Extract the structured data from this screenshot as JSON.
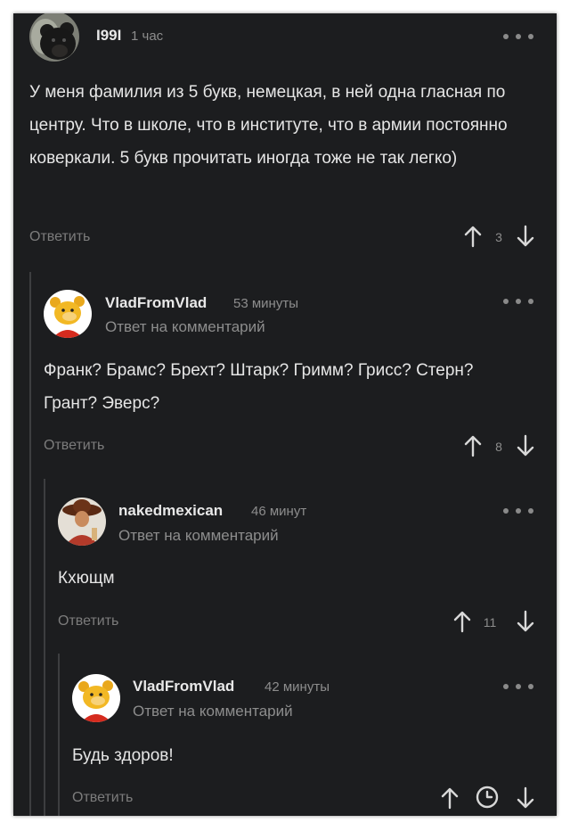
{
  "comments": [
    {
      "author": "I99I",
      "time": "1 час",
      "text": "У меня фамилия из 5 букв, немецкая, в ней одна гласная по центру. Что в школе, что в институте, что в армии постоянно коверкали. 5 букв прочитать иногда тоже не так легко)",
      "reply_label": "Ответить",
      "rating": "3",
      "avatar_icon": "bear-avatar"
    },
    {
      "author": "VladFromVlad",
      "time": "53 минуты",
      "subtitle": "Ответ на комментарий",
      "text": "Франк? Брамс? Брехт? Штарк? Гримм? Грисс? Стерн? Грант? Эверс?",
      "reply_label": "Ответить",
      "rating": "8",
      "avatar_icon": "winnie-avatar"
    },
    {
      "author": "nakedmexican",
      "time": "46 минут",
      "subtitle": "Ответ на комментарий",
      "text": "Кхющм",
      "reply_label": "Ответить",
      "rating": "11",
      "avatar_icon": "mexican-avatar"
    },
    {
      "author": "VladFromVlad",
      "time": "42 минуты",
      "subtitle": "Ответ на комментарий",
      "text": "Будь здоров!",
      "reply_label": "Ответить",
      "avatar_icon": "winnie-avatar"
    }
  ],
  "colors": {
    "background": "#1c1d1f",
    "text": "#e6e6e6",
    "muted": "#8d8d8d"
  }
}
